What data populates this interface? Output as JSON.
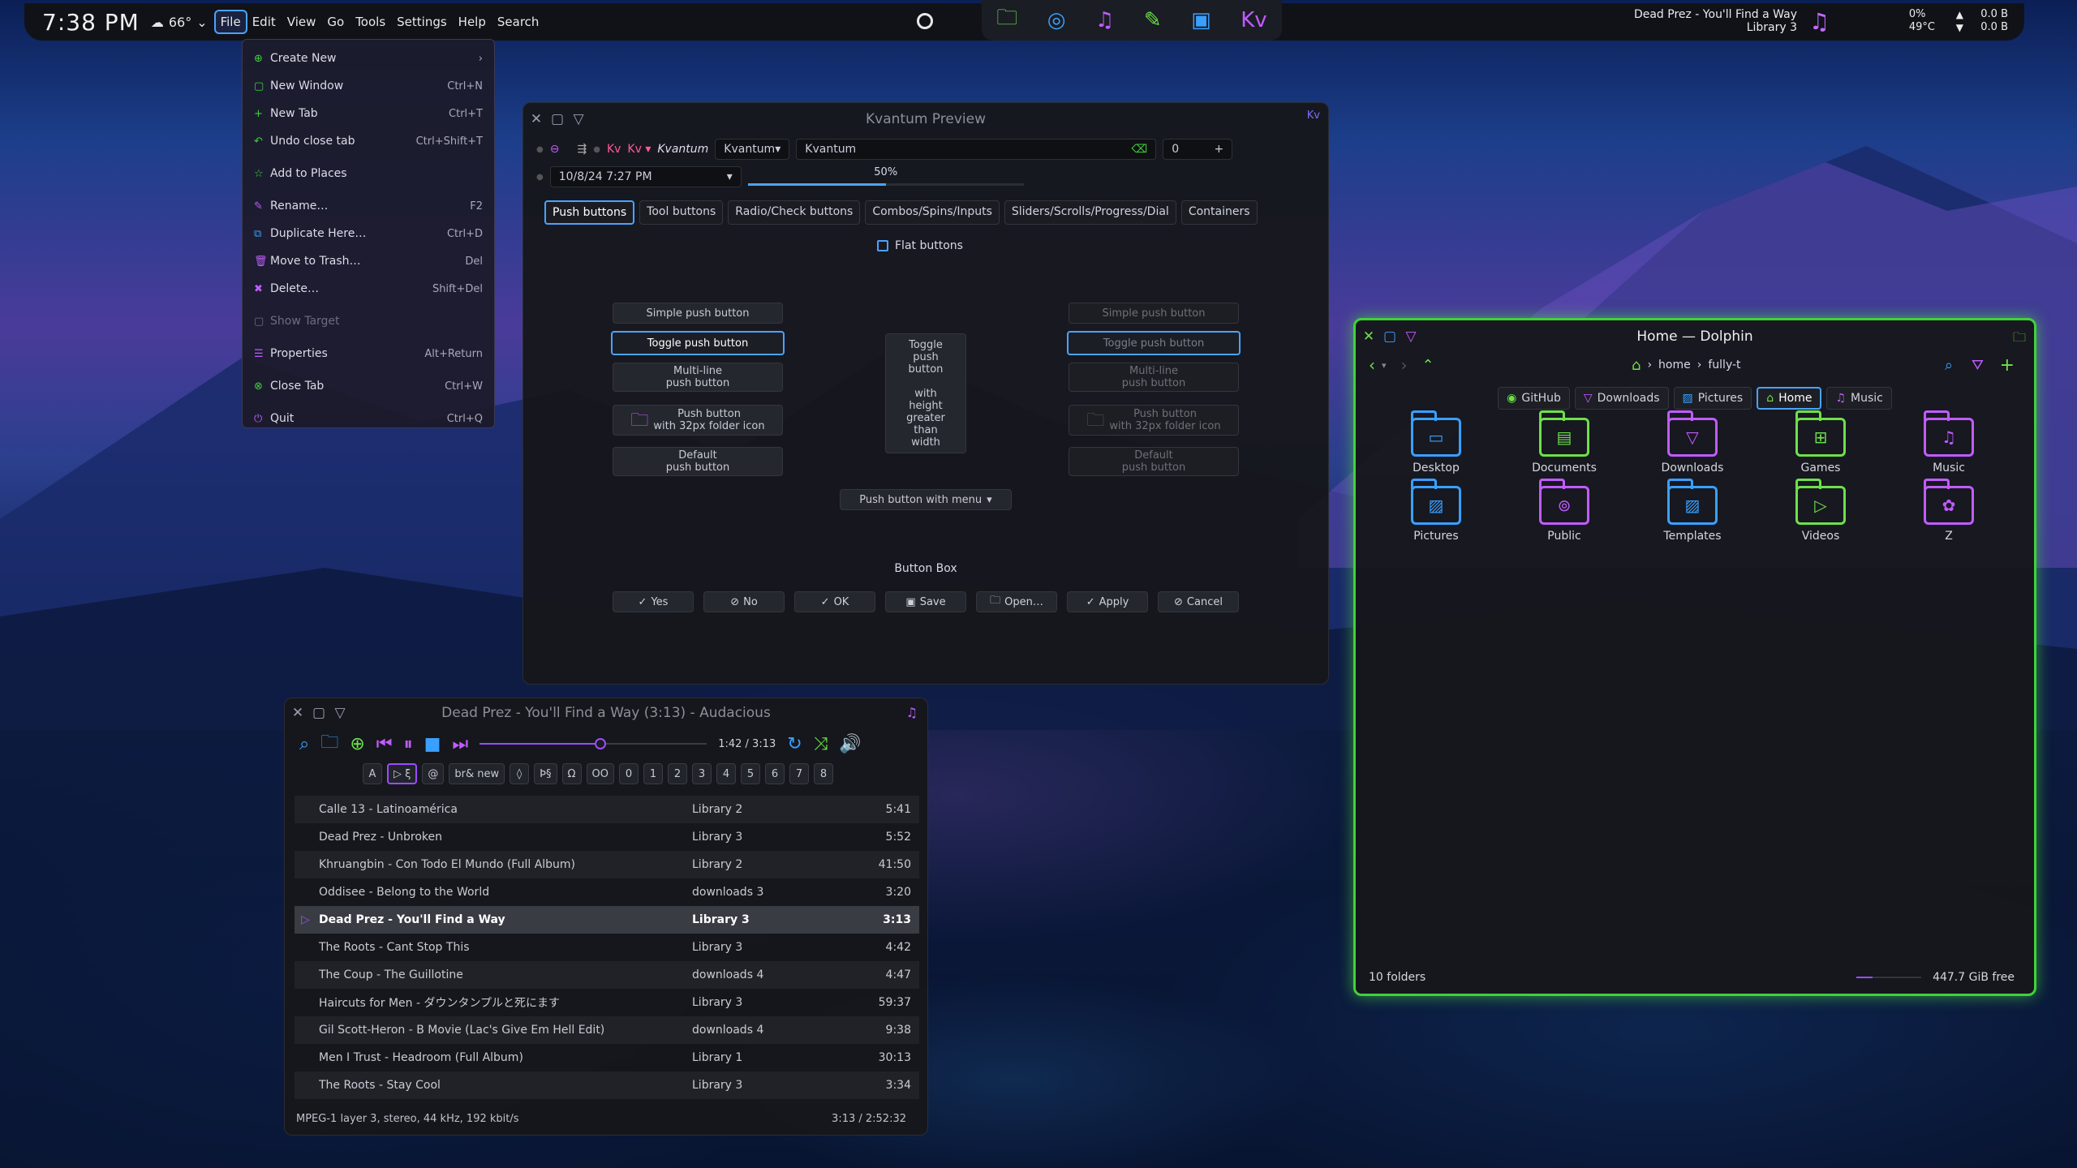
{
  "panel": {
    "time": "7:38 PM",
    "temp": "66°",
    "menus": [
      "File",
      "Edit",
      "View",
      "Go",
      "Tools",
      "Settings",
      "Help",
      "Search"
    ],
    "now_playing_title": "Dead Prez - You'll Find a Way",
    "now_playing_sub": "Library 3",
    "cpu": "0%",
    "cpu_temp": "49°C",
    "net_up": "0.0 B",
    "net_down": "0.0 B"
  },
  "file_menu": {
    "items": [
      {
        "label": "Create New",
        "shortcut": "›",
        "icon": "⊕"
      },
      {
        "label": "New Window",
        "shortcut": "Ctrl+N",
        "icon": "▢"
      },
      {
        "label": "New Tab",
        "shortcut": "Ctrl+T",
        "icon": "+"
      },
      {
        "label": "Undo close tab",
        "shortcut": "Ctrl+Shift+T",
        "icon": "↶"
      },
      {
        "label": "Add to Places",
        "shortcut": "",
        "icon": "☆"
      },
      {
        "label": "Rename…",
        "shortcut": "F2",
        "icon": "✎"
      },
      {
        "label": "Duplicate Here…",
        "shortcut": "Ctrl+D",
        "icon": "⧉"
      },
      {
        "label": "Move to Trash…",
        "shortcut": "Del",
        "icon": "🗑"
      },
      {
        "label": "Delete…",
        "shortcut": "Shift+Del",
        "icon": "✖"
      },
      {
        "label": "Show Target",
        "shortcut": "",
        "icon": "▢"
      },
      {
        "label": "Properties",
        "shortcut": "Alt+Return",
        "icon": "☰"
      },
      {
        "label": "Close Tab",
        "shortcut": "Ctrl+W",
        "icon": "⊗"
      },
      {
        "label": "Quit",
        "shortcut": "Ctrl+Q",
        "icon": "⏻"
      }
    ]
  },
  "kvantum": {
    "title": "Kvantum Preview",
    "style_label": "Kvantum",
    "style_combo": "Kvantum",
    "line_edit": "Kvantum",
    "spin": "0",
    "datetime": "10/8/24 7:27 PM",
    "progress": "50%",
    "progress_value": 0.5,
    "tabs": [
      "Push buttons",
      "Tool buttons",
      "Radio/Check buttons",
      "Combos/Spins/Inputs",
      "Sliders/Scrolls/Progress/Dial",
      "Containers"
    ],
    "flat_label": "Flat buttons",
    "simple": "Simple push button",
    "toggle": "Toggle push button",
    "multiline": "Multi-line\npush button",
    "folder": "Push button\nwith 32px folder icon",
    "default": "Default\npush button",
    "tall": "Toggle\npush\nbutton\n\nwith\nheight\ngreater\nthan\nwidth",
    "menu_btn": "Push button with menu",
    "button_box": "Button Box",
    "box_buttons": [
      "Yes",
      "No",
      "OK",
      "Save",
      "Open…",
      "Apply",
      "Cancel"
    ]
  },
  "audacious": {
    "title": "Dead Prez - You'll Find a Way (3:13) - Audacious",
    "time": "1:42 / 3:13",
    "position": 0.53,
    "chips": [
      "A",
      "▷ ξ",
      "@",
      "br& new",
      "◊",
      "Þ§",
      "Ω",
      "OO",
      "0",
      "1",
      "2",
      "3",
      "4",
      "5",
      "6",
      "7",
      "8"
    ],
    "rows": [
      {
        "t": "Calle 13 - Latinoamérica",
        "a": "Library 2",
        "d": "5:41"
      },
      {
        "t": "Dead Prez - Unbroken",
        "a": "Library 3",
        "d": "5:52"
      },
      {
        "t": "Khruangbin - Con Todo El Mundo (Full Album)",
        "a": "Library 2",
        "d": "41:50"
      },
      {
        "t": "Oddisee - Belong to the World",
        "a": "downloads 3",
        "d": "3:20"
      },
      {
        "t": "Dead Prez - You'll Find a Way",
        "a": "Library 3",
        "d": "3:13"
      },
      {
        "t": "The Roots - Cant Stop This",
        "a": "Library 3",
        "d": "4:42"
      },
      {
        "t": "The Coup - The Guillotine",
        "a": "downloads 4",
        "d": "4:47"
      },
      {
        "t": "Haircuts for Men - ダウンタンプルと死にます",
        "a": "Library 3",
        "d": "59:37"
      },
      {
        "t": "Gil Scott-Heron - B Movie (Lac's Give Em Hell Edit)",
        "a": "downloads 4",
        "d": "9:38"
      },
      {
        "t": "Men I Trust - Headroom (Full Album)",
        "a": "Library 1",
        "d": "30:13"
      },
      {
        "t": "The Roots - Stay Cool",
        "a": "Library 3",
        "d": "3:34"
      }
    ],
    "status_left": "MPEG-1 layer 3, stereo, 44 kHz, 192 kbit/s",
    "status_right": "3:13 / 2:52:32"
  },
  "dolphin": {
    "title": "Home — Dolphin",
    "breadcrumb_home": "home",
    "breadcrumb_user": "fully-t",
    "places": [
      "GitHub",
      "Downloads",
      "Pictures",
      "Home",
      "Music"
    ],
    "folders": [
      {
        "name": "Desktop",
        "color": "#3aa0ff",
        "glyph": "▭"
      },
      {
        "name": "Documents",
        "color": "#6ee04a",
        "glyph": "▤"
      },
      {
        "name": "Downloads",
        "color": "#c15cff",
        "glyph": "▽"
      },
      {
        "name": "Games",
        "color": "#6ee04a",
        "glyph": "⊞"
      },
      {
        "name": "Music",
        "color": "#c15cff",
        "glyph": "♫"
      },
      {
        "name": "Pictures",
        "color": "#3aa0ff",
        "glyph": "▨"
      },
      {
        "name": "Public",
        "color": "#c15cff",
        "glyph": "⊚"
      },
      {
        "name": "Templates",
        "color": "#3aa0ff",
        "glyph": "▨"
      },
      {
        "name": "Videos",
        "color": "#6ee04a",
        "glyph": "▷"
      },
      {
        "name": "Z",
        "color": "#c15cff",
        "glyph": "✿"
      }
    ],
    "status_left": "10 folders",
    "free": "447.7 GiB free",
    "used_fraction": 0.25
  },
  "colors": {
    "accent_blue": "#4aa3ff",
    "accent_purple": "#9b4dff",
    "accent_green": "#41d13a"
  }
}
